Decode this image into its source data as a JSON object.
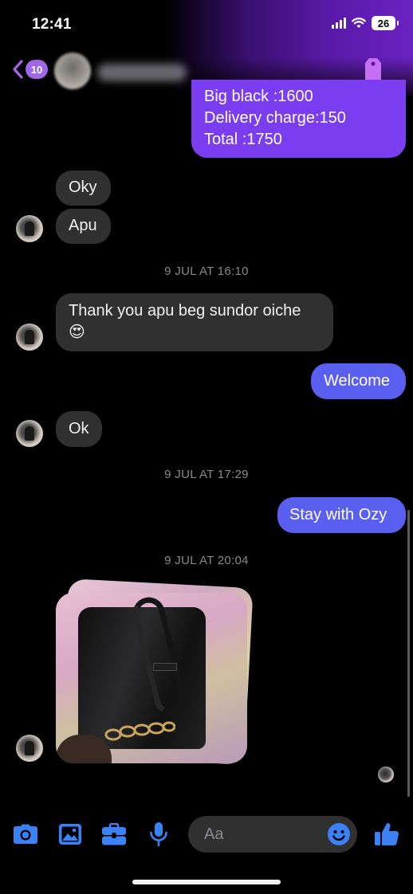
{
  "status_bar": {
    "time": "12:41",
    "battery": "26"
  },
  "header": {
    "back_count": "10"
  },
  "messages": [
    {
      "id": "order",
      "lines": [
        "Big black :1600",
        "Delivery charge:150",
        "Total :1750"
      ]
    },
    {
      "id": "oky",
      "text": "Oky"
    },
    {
      "id": "apu",
      "text": "Apu"
    },
    {
      "id": "ts1",
      "text": "9 JUL AT 16:10"
    },
    {
      "id": "thanks",
      "text": "Thank you apu beg sundor oiche",
      "emoji": "😍"
    },
    {
      "id": "welcome",
      "text": "Welcome"
    },
    {
      "id": "ok",
      "text": "Ok"
    },
    {
      "id": "ts2",
      "text": "9 JUL AT 17:29"
    },
    {
      "id": "stay",
      "text": "Stay with Ozy"
    },
    {
      "id": "ts3",
      "text": "9 JUL AT 20:04"
    }
  ],
  "composer": {
    "placeholder": "Aa"
  },
  "colors": {
    "accent": "#3b82f6",
    "outgoing": "#5a5ff0",
    "incoming": "#303030",
    "brand_purple": "#7a3ef0"
  },
  "icons": [
    "camera-icon",
    "gallery-icon",
    "briefcase-icon",
    "microphone-icon",
    "emoji-icon",
    "thumbs-up-icon",
    "tag-icon",
    "back-chevron-icon"
  ]
}
